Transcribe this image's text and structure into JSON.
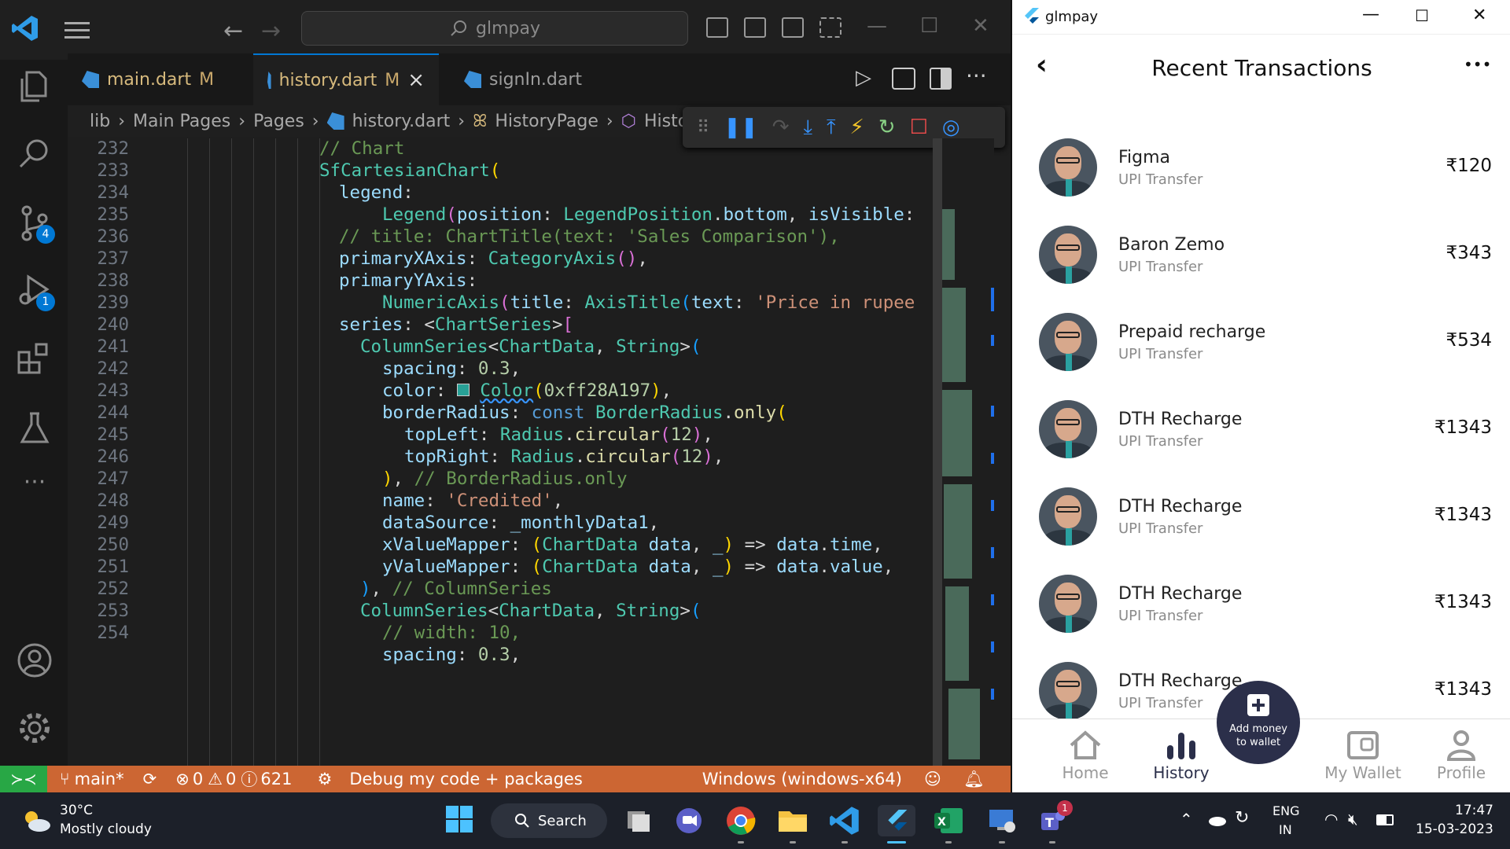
{
  "vscode": {
    "search_text": "glmpay",
    "tabs": [
      {
        "name": "main.dart",
        "status": "M"
      },
      {
        "name": "history.dart",
        "status": "M",
        "close": "×"
      },
      {
        "name": "signIn.dart"
      }
    ],
    "breadcrumb": [
      "lib",
      "Main Pages",
      "Pages",
      "history.dart",
      "HistoryPage",
      "Histor"
    ],
    "badges": {
      "source_control": "4",
      "run_debug": "1"
    },
    "status": {
      "branch": "main*",
      "errors": "0",
      "warnings": "0",
      "info": "621",
      "debug_mode": "Debug my code + packages",
      "platform": "Windows (windows-x64)"
    },
    "line_numbers": [
      "232",
      "233",
      "234",
      "235",
      "236",
      "237",
      "238",
      "239",
      "240",
      "241",
      "242",
      "243",
      "244",
      "245",
      "246",
      "247",
      "248",
      "249",
      "250",
      "251",
      "252",
      "253",
      "254"
    ]
  },
  "app": {
    "window_title": "glmpay",
    "page_title": "Recent Transactions",
    "more": "•••",
    "transactions": [
      {
        "name": "Figma",
        "sub": "UPI Transfer",
        "amount": "₹120"
      },
      {
        "name": "Baron Zemo",
        "sub": "UPI Transfer",
        "amount": "₹343"
      },
      {
        "name": "Prepaid recharge",
        "sub": "UPI Transfer",
        "amount": "₹534"
      },
      {
        "name": "DTH Recharge",
        "sub": "UPI Transfer",
        "amount": "₹1343"
      },
      {
        "name": "DTH Recharge",
        "sub": "UPI Transfer",
        "amount": "₹1343"
      },
      {
        "name": "DTH Recharge",
        "sub": "UPI Transfer",
        "amount": "₹1343"
      },
      {
        "name": "DTH Recharge",
        "sub": "UPI Transfer",
        "amount": "₹1343"
      }
    ],
    "fab": {
      "line1": "Add money",
      "line2": "to wallet"
    },
    "nav": {
      "home": "Home",
      "history": "History",
      "wallet": "My Wallet",
      "profile": "Profile"
    }
  },
  "taskbar": {
    "weather_temp": "30°C",
    "weather_desc": "Mostly cloudy",
    "search": "Search",
    "lang1": "ENG",
    "lang2": "IN",
    "time": "17:47",
    "date": "15-03-2023",
    "teams_badge": "1"
  },
  "colors": {
    "accent": "#0078d4",
    "status_bar": "#cc6633",
    "swatch": "#28A197",
    "app_fab": "#2b2f4a"
  }
}
